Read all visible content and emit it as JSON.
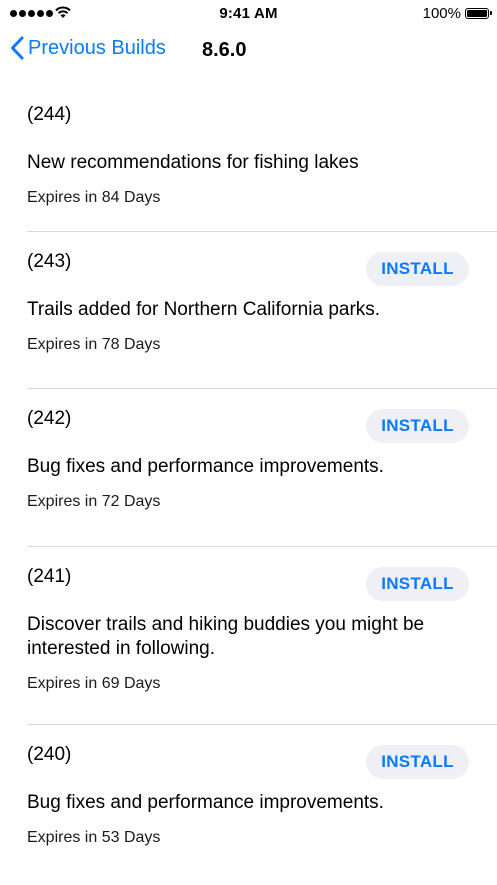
{
  "status_bar": {
    "time": "9:41 AM",
    "battery": "100%"
  },
  "nav": {
    "back_label": "Previous Builds",
    "title": "8.6.0"
  },
  "install_label": "INSTALL",
  "accent_color": "#0a7aff",
  "builds": [
    {
      "number": "(244)",
      "notes": "New recommendations for fishing lakes",
      "expires": "Expires in 84 Days"
    },
    {
      "number": "(243)",
      "notes": "Trails added for Northern California parks.",
      "expires": "Expires in 78 Days"
    },
    {
      "number": "(242)",
      "notes": "Bug fixes and performance improvements.",
      "expires": "Expires in 72 Days"
    },
    {
      "number": "(241)",
      "notes": "Discover trails and hiking buddies you might be interested in following.",
      "expires": "Expires in 69 Days"
    },
    {
      "number": "(240)",
      "notes": "Bug fixes and performance improvements.",
      "expires": "Expires in 53 Days"
    }
  ]
}
